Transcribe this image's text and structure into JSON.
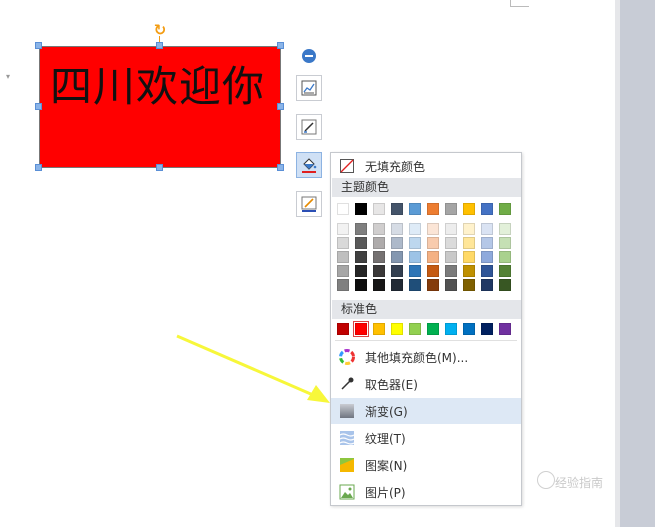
{
  "textbox": {
    "text": "四川欢迎你",
    "fill": "#ff0000"
  },
  "menu": {
    "no_fill_label": "无填充颜色",
    "theme_colors_label": "主题颜色",
    "standard_colors_label": "标准色",
    "more_colors_label": "其他填充颜色(M)...",
    "eyedropper_label": "取色器(E)",
    "gradient_label": "渐变(G)",
    "texture_label": "纹理(T)",
    "pattern_label": "图案(N)",
    "picture_label": "图片(P)"
  },
  "theme_colors": {
    "top_row": [
      "#ffffff",
      "#000000",
      "#e7e6e6",
      "#44546a",
      "#5b9bd5",
      "#ed7d31",
      "#a5a5a5",
      "#ffc000",
      "#4472c4",
      "#70ad47"
    ],
    "shades": [
      [
        "#f2f2f2",
        "#7f7f7f",
        "#d0cece",
        "#d6dce5",
        "#deebf7",
        "#fbe5d6",
        "#ededed",
        "#fff2cc",
        "#dae3f3",
        "#e2f0d9"
      ],
      [
        "#d9d9d9",
        "#595959",
        "#aeabab",
        "#adb9ca",
        "#bdd7ee",
        "#f8cbad",
        "#dbdbdb",
        "#ffe699",
        "#b4c7e7",
        "#c5e0b4"
      ],
      [
        "#bfbfbf",
        "#404040",
        "#757171",
        "#8497b0",
        "#9dc3e6",
        "#f4b183",
        "#c9c9c9",
        "#ffd966",
        "#8faadc",
        "#a9d18e"
      ],
      [
        "#a6a6a6",
        "#262626",
        "#3a3838",
        "#333f50",
        "#2e75b6",
        "#c55a11",
        "#7b7b7b",
        "#bf9000",
        "#2f5597",
        "#548235"
      ],
      [
        "#808080",
        "#0d0d0d",
        "#171616",
        "#222a35",
        "#1f4e79",
        "#843c0c",
        "#525252",
        "#7f6000",
        "#203864",
        "#385723"
      ]
    ]
  },
  "standard_colors": [
    "#c00000",
    "#ff0000",
    "#ffc000",
    "#ffff00",
    "#92d050",
    "#00b050",
    "#00b0f0",
    "#0070c0",
    "#002060",
    "#7030a0"
  ],
  "watermark": "经验指南",
  "accent_arrow": "#f7f73a"
}
